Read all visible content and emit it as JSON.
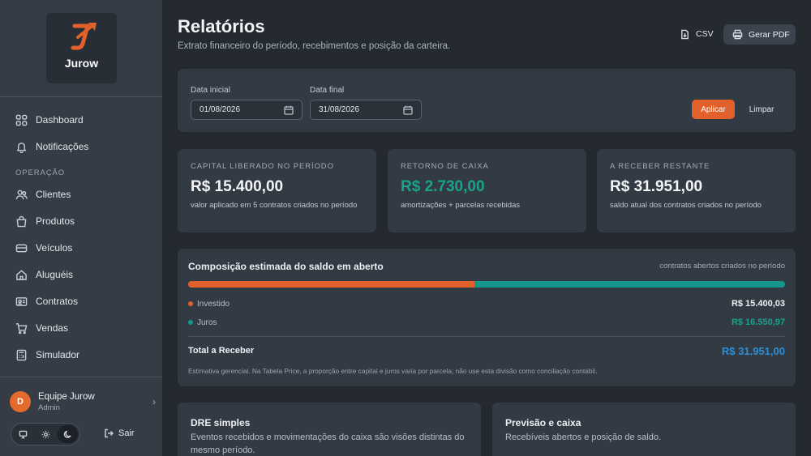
{
  "app": {
    "logo_text": "Jurow"
  },
  "sidebar": {
    "items_top": [
      {
        "label": "Dashboard",
        "icon": "grid-icon"
      },
      {
        "label": "Notificações",
        "icon": "bell-icon"
      }
    ],
    "section_label": "OPERAÇÃO",
    "items": [
      {
        "label": "Clientes",
        "icon": "users-icon"
      },
      {
        "label": "Produtos",
        "icon": "bag-icon"
      },
      {
        "label": "Veículos",
        "icon": "vehicle-icon"
      },
      {
        "label": "Aluguéis",
        "icon": "home-icon"
      },
      {
        "label": "Contratos",
        "icon": "contract-icon"
      },
      {
        "label": "Vendas",
        "icon": "cart-icon"
      },
      {
        "label": "Simulador",
        "icon": "calculator-icon"
      }
    ],
    "user": {
      "initial": "D",
      "name": "Equipe Jurow",
      "role": "Admin"
    },
    "theme": {
      "options": [
        "monitor-icon",
        "sun-icon",
        "moon-icon"
      ],
      "active": "moon-icon"
    },
    "logout_label": "Sair"
  },
  "header": {
    "title": "Relatórios",
    "subtitle": "Extrato financeiro do período, recebimentos e posição da carteira.",
    "csv_label": "CSV",
    "pdf_label": "Gerar PDF"
  },
  "filters": {
    "start_label": "Data inicial",
    "start_value": "01/08/2026",
    "end_label": "Data final",
    "end_value": "31/08/2026",
    "apply_label": "Aplicar",
    "clear_label": "Limpar"
  },
  "stats": [
    {
      "label": "CAPITAL LIBERADO NO PERÍODO",
      "value": "R$ 15.400,00",
      "desc": "valor aplicado em 5 contratos criados no período"
    },
    {
      "label": "RETORNO DE CAIXA",
      "value": "R$ 2.730,00",
      "desc": "amortizações + parcelas recebidas"
    },
    {
      "label": "A RECEBER RESTANTE",
      "value": "R$ 31.951,00",
      "desc": "saldo atual dos contratos criados no período"
    }
  ],
  "composition": {
    "title": "Composição estimada do saldo em aberto",
    "note": "contratos abertos criados no período",
    "invested_fraction": 0.48,
    "rows": [
      {
        "name": "Investido",
        "value": "R$ 15.400,03",
        "color": "#e2612a"
      },
      {
        "name": "Juros",
        "value": "R$ 16.550,97",
        "color": "#14978a"
      }
    ],
    "total_label": "Total a Receber",
    "total_value": "R$ 31.951,00",
    "footnote": "Estimativa gerencial. Na Tabela Price, a proporção entre capital e juros varia por parcela; não use esta divisão como conciliação contábil."
  },
  "dre": {
    "title": "DRE simples",
    "desc": "Eventos recebidos e movimentações do caixa são visões distintas do mesmo período."
  },
  "forecast": {
    "title": "Previsão e caixa",
    "desc": "Recebíveis abertos e posição de saldo."
  },
  "colors": {
    "accent": "#e2612a",
    "teal": "#14978a",
    "blue": "#2e8fd6"
  }
}
